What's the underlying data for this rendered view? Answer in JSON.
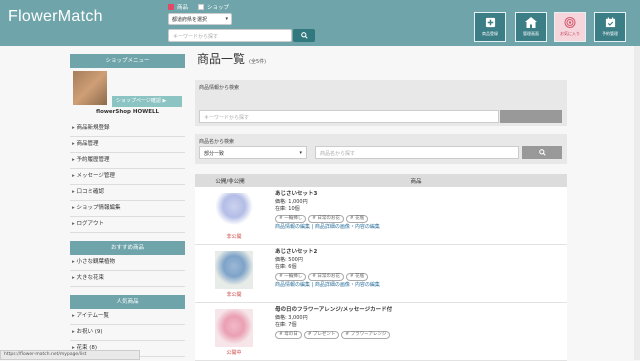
{
  "app": {
    "title": "FlowerMatch"
  },
  "header": {
    "radio_product": "商品",
    "radio_shop": "ショップ",
    "pref_select": "都道府県を選択",
    "keyword_placeholder": "キーワードから探す",
    "nav": [
      {
        "label": "商品登録",
        "icon": "plus-square-icon"
      },
      {
        "label": "管理画面",
        "icon": "home-icon"
      },
      {
        "label": "お気に入り",
        "icon": "heart-icon"
      },
      {
        "label": "予約管理",
        "icon": "calendar-check-icon"
      }
    ],
    "colors": {
      "bar": "#6fa4aa",
      "nav_btn": "#3b7e86",
      "active_btn": "#f6d5dc"
    }
  },
  "sidebar": {
    "shop_menu_title": "ショップメニュー",
    "shop_page_btn": "ショップページ確認 ▶",
    "shop_name": "flowerShop HOWELL",
    "menu": [
      "商品新規登録",
      "商品管理",
      "予約履歴管理",
      "メッセージ管理",
      "口コミ確認",
      "ショップ情報編集",
      "ログアウト"
    ],
    "recommend_title": "おすすめ商品",
    "recommend": [
      "小さな観葉植物",
      "大きな花束"
    ],
    "popular_title": "人気商品",
    "popular": [
      "アイテム一覧",
      "お祝い (9)",
      "花束 (8)"
    ]
  },
  "main": {
    "title": "商品一覧",
    "count": "(全5件)",
    "search_info_label": "商品情報から検索",
    "search_info_placeholder": "キーワードから探す",
    "search_name_label": "商品名から検索",
    "match_select": "部分一致",
    "search_name_placeholder": "商品名から探す",
    "col_public": "公開/非公開",
    "col_product": "商品",
    "rows": [
      {
        "status": "非公開",
        "name": "あじさいセット3",
        "price": "価格: 1,000円",
        "stock": "在庫: 10個",
        "tags": [
          "# 一輪挿し",
          "# 日常のお花",
          "# 花瓶"
        ],
        "links": "商品情報の編集 | 商品詳細の画像・内容の編集"
      },
      {
        "status": "非公開",
        "name": "あじさいセット2",
        "price": "価格: 500円",
        "stock": "在庫: 6個",
        "tags": [
          "# 一輪挿し",
          "# 日常のお花",
          "# 花瓶"
        ],
        "links": "商品情報の編集 | 商品詳細の画像・内容の編集"
      },
      {
        "status": "公開中",
        "name": "母の日のフラワーアレンジ/メッセージカード付",
        "price": "価格: 3,000円",
        "stock": "在庫: 7個",
        "tags": [
          "# 母の日",
          "# プレゼント",
          "# フラワーアレンジ"
        ],
        "links": ""
      }
    ]
  },
  "statusbar": {
    "url": "https://flower-match.net/mypage/list"
  }
}
